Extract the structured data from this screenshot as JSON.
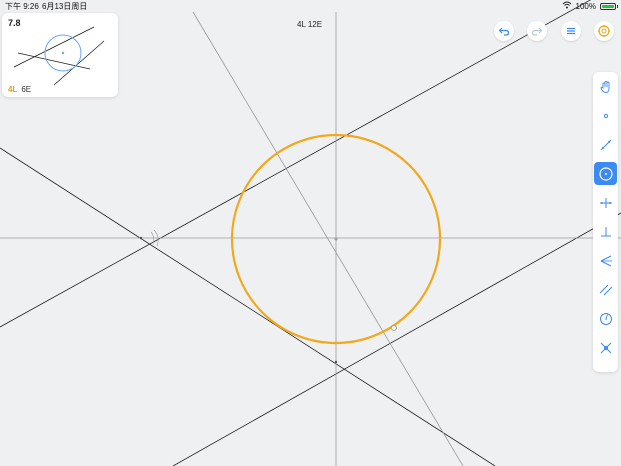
{
  "status_bar": {
    "time": "下午 9:26",
    "date": "6月13日周日",
    "battery": "100%"
  },
  "level": {
    "number": "7.8",
    "lines_goal": "4L",
    "euclid_goal": "6E"
  },
  "move_counter": "4L 12E",
  "colors": {
    "background": "#eff0f2",
    "accent": "#3b8bf2",
    "circle": "#f2a81d",
    "given_line": "#222222",
    "construction_line": "#9a9a9a"
  },
  "top_buttons": [
    {
      "name": "undo-button",
      "icon": "undo-icon"
    },
    {
      "name": "redo-button",
      "icon": "redo-icon"
    },
    {
      "name": "menu-button",
      "icon": "menu-icon"
    },
    {
      "name": "hint-button",
      "icon": "hint-icon"
    }
  ],
  "tools": [
    {
      "name": "tool-move",
      "icon": "hand-icon",
      "active": false
    },
    {
      "name": "tool-point",
      "icon": "point-icon",
      "active": false
    },
    {
      "name": "tool-line",
      "icon": "line-icon",
      "active": false
    },
    {
      "name": "tool-circle",
      "icon": "circle-icon",
      "active": true
    },
    {
      "name": "tool-perpendicular-bisector",
      "icon": "perpendicular-bisector-icon",
      "active": false
    },
    {
      "name": "tool-perpendicular",
      "icon": "perpendicular-icon",
      "active": false
    },
    {
      "name": "tool-angle-bisector",
      "icon": "angle-bisector-icon",
      "active": false
    },
    {
      "name": "tool-parallel",
      "icon": "parallel-icon",
      "active": false
    },
    {
      "name": "tool-compass",
      "icon": "compass-icon",
      "active": false
    },
    {
      "name": "tool-intersect",
      "icon": "intersect-icon",
      "active": false
    }
  ]
}
